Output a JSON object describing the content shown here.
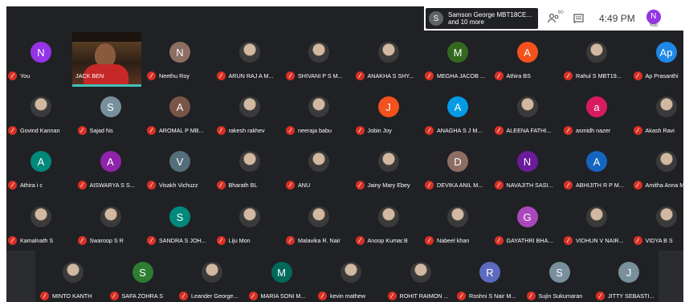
{
  "presentation_pill": {
    "avatar_letter": "S",
    "line1": "Samson George MBT18CE...",
    "line2": "and 10 more"
  },
  "controls": {
    "people_count": "60",
    "time": "4:49 PM",
    "me_letter": "N",
    "me_label": "You"
  },
  "colors": {
    "background": "#202124",
    "muted": "#d93025",
    "speaking": "#3ec4b7"
  },
  "participants": [
    [
      {
        "name": "You",
        "letter": "N",
        "color": "#9334e6"
      },
      {
        "name": "JACK BEN",
        "letter": "",
        "video": true
      },
      {
        "name": "Neethu Roy",
        "letter": "N",
        "color": "#8d6e63"
      },
      {
        "name": "ARUN RAJ A M...",
        "letter": "",
        "color": "#1a237e"
      },
      {
        "name": "SHIVANI P S M...",
        "letter": "",
        "color": "#6d4c41"
      },
      {
        "name": "ANAKHA S SHY...",
        "letter": "",
        "color": "#ad1457"
      },
      {
        "name": "MEGHA JACOB ...",
        "letter": "M",
        "color": "#33691e"
      },
      {
        "name": "Athira BS",
        "letter": "A",
        "color": "#f4511e"
      },
      {
        "name": "Rahul S MBT19...",
        "letter": "",
        "color": "#4e342e"
      },
      {
        "name": "Ap Prasanthi",
        "letter": "Ap",
        "color": "#1e88e5"
      }
    ],
    [
      {
        "name": "Govind Kannan",
        "letter": "",
        "color": "#6d4c41"
      },
      {
        "name": "Sajad Ns",
        "letter": "S",
        "color": "#78909c"
      },
      {
        "name": "AROMAL P MB...",
        "letter": "A",
        "color": "#795548"
      },
      {
        "name": "rakesh rakhev",
        "letter": "",
        "color": "#3e2723"
      },
      {
        "name": "neeraja babu",
        "letter": "",
        "color": "#eeeeee"
      },
      {
        "name": "Jobin Joy",
        "letter": "J",
        "color": "#f4511e"
      },
      {
        "name": "ANAGHA S J M...",
        "letter": "A",
        "color": "#039be5"
      },
      {
        "name": "ALEENA FATHI...",
        "letter": "",
        "color": "#8d6e63"
      },
      {
        "name": "asmidh nazer",
        "letter": "a",
        "color": "#d81b60"
      },
      {
        "name": "Akash Ravi",
        "letter": "",
        "color": "#a1887f"
      }
    ],
    [
      {
        "name": "Athira i c",
        "letter": "A",
        "color": "#00897b"
      },
      {
        "name": "AISWARYA S S...",
        "letter": "A",
        "color": "#8e24aa"
      },
      {
        "name": "Visakh Vichuzz",
        "letter": "V",
        "color": "#546e7a"
      },
      {
        "name": "Bharath BL",
        "letter": "",
        "color": "#5d4037"
      },
      {
        "name": "ANU",
        "letter": "",
        "color": "#455a64"
      },
      {
        "name": "Jainy Mary Ebey",
        "letter": "",
        "color": "#4e342e"
      },
      {
        "name": "DEVIKA ANIL M...",
        "letter": "D",
        "color": "#8d6e63"
      },
      {
        "name": "NAVAJITH SASI...",
        "letter": "N",
        "color": "#6a1b9a"
      },
      {
        "name": "ABHIJITH R P M...",
        "letter": "A",
        "color": "#1565c0"
      },
      {
        "name": "Amitha Anna M...",
        "letter": "",
        "color": "#5d4037"
      }
    ],
    [
      {
        "name": "Kamalnath S",
        "letter": "",
        "color": "#6d4c41"
      },
      {
        "name": "Swaroop S R",
        "letter": "",
        "color": "#546e7a"
      },
      {
        "name": "SANDRA S JOH...",
        "letter": "S",
        "color": "#00897b"
      },
      {
        "name": "Liju Mon",
        "letter": "",
        "color": "#37474f"
      },
      {
        "name": "Malavika R. Nair",
        "letter": "",
        "color": "#4e342e"
      },
      {
        "name": "Anoop Kumar.B",
        "letter": "",
        "color": "#607d8b"
      },
      {
        "name": "Nabeel khan",
        "letter": "",
        "color": "#3e2723"
      },
      {
        "name": "GAYATHRI BHA...",
        "letter": "G",
        "color": "#ab47bc"
      },
      {
        "name": "VIDHUN V NAIR...",
        "letter": "",
        "color": "#4e342e"
      },
      {
        "name": "VIDYA B S",
        "letter": "",
        "color": "#424242"
      }
    ],
    [
      {
        "name": "MINTO KANTH",
        "letter": "",
        "color": "#8d6e63"
      },
      {
        "name": "SAFA ZOHRA S",
        "letter": "S",
        "color": "#2e7d32"
      },
      {
        "name": "Leander George...",
        "letter": "",
        "color": "#a1887f"
      },
      {
        "name": "MARIA SONI M...",
        "letter": "M",
        "color": "#00695c"
      },
      {
        "name": "kevin mathew",
        "letter": "",
        "color": "#eeeeee"
      },
      {
        "name": "ROHIT RAIMON ...",
        "letter": "",
        "color": "#795548"
      },
      {
        "name": "Roshni S Nair M...",
        "letter": "R",
        "color": "#5c6bc0"
      },
      {
        "name": "Sujin Sukumaran",
        "letter": "S",
        "color": "#78909c"
      },
      {
        "name": "JITTY SEBASTI...",
        "letter": "J",
        "color": "#78909c"
      }
    ]
  ]
}
